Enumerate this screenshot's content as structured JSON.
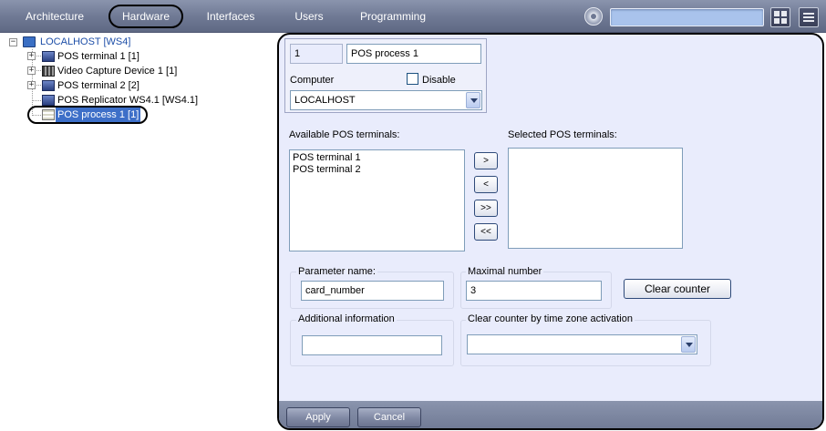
{
  "menu": {
    "tabs": [
      {
        "label": "Architecture"
      },
      {
        "label": "Hardware"
      },
      {
        "label": "Interfaces"
      },
      {
        "label": "Users"
      },
      {
        "label": "Programming"
      }
    ],
    "active_tab": "Hardware",
    "search_value": ""
  },
  "tree": {
    "root": {
      "label": "LOCALHOST [WS4]",
      "icon": "monitor-icon",
      "expanded": true
    },
    "children": [
      {
        "label": "POS terminal 1 [1]",
        "icon": "pos-terminal-icon",
        "expandable": true
      },
      {
        "label": "Video Capture Device 1 [1]",
        "icon": "video-capture-icon",
        "expandable": true
      },
      {
        "label": "POS terminal 2 [2]",
        "icon": "pos-terminal-icon",
        "expandable": true
      },
      {
        "label": "POS Replicator WS4.1 [WS4.1]",
        "icon": "pos-terminal-icon",
        "expandable": false
      },
      {
        "label": "POS process 1 [1]",
        "icon": "pos-process-icon",
        "expandable": false,
        "selected": true
      }
    ]
  },
  "settings": {
    "id": "1",
    "name": "POS process 1",
    "computer_label": "Computer",
    "disable_label": "Disable",
    "disable_checked": false,
    "computer_value": "LOCALHOST",
    "available_label": "Available POS terminals:",
    "available_items": [
      "POS terminal 1",
      "POS terminal 2"
    ],
    "selected_label": "Selected POS terminals:",
    "selected_items": [],
    "move_buttons": {
      "add": ">",
      "remove": "<",
      "add_all": ">>",
      "remove_all": "<<"
    },
    "parameter_name_label": "Parameter name:",
    "parameter_name_value": "card_number",
    "maximal_number_label": "Maximal number",
    "maximal_number_value": "3",
    "clear_counter_label": "Clear counter",
    "additional_info_label": "Additional information",
    "additional_info_value": "",
    "time_zone_label": "Clear counter by time zone activation",
    "time_zone_value": ""
  },
  "footer": {
    "apply_label": "Apply",
    "cancel_label": "Cancel"
  },
  "colors": {
    "menu_bar": "#6e7893",
    "panel_bg": "#e9ecfc",
    "selection": "#3d6fc8"
  }
}
